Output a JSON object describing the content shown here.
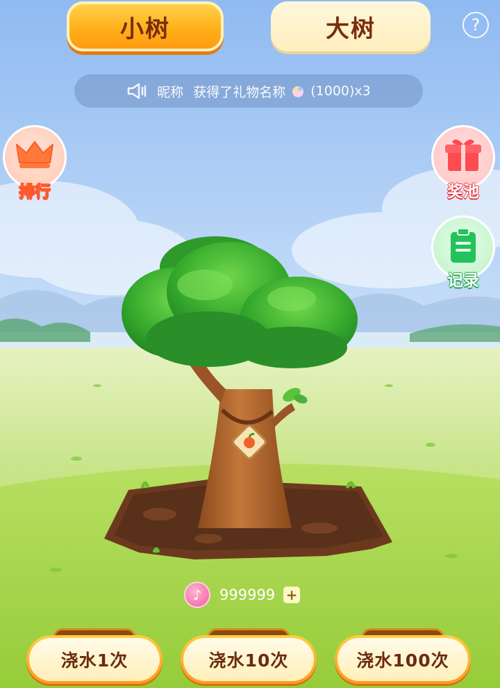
{
  "tabs": {
    "small": "小树",
    "big": "大树"
  },
  "help_glyph": "?",
  "marquee": {
    "nickname": "昵称",
    "action": "获得了礼物名称",
    "amount": "(1000)x3"
  },
  "side": {
    "rank": "排行",
    "prize_pool": "奖池",
    "record": "记录"
  },
  "coins": {
    "value": "999999",
    "plus": "+"
  },
  "water_buttons": [
    "浇水1次",
    "浇水10次",
    "浇水100次"
  ],
  "icons": [
    "help-icon",
    "speaker-icon",
    "gift-item-icon",
    "crown-icon",
    "gift-box-icon",
    "clipboard-icon",
    "apple-badge-icon",
    "music-coin-icon",
    "plus-icon"
  ],
  "colors": {
    "tab_active": "#ffb01c",
    "tab_text": "#7a2d0a",
    "rank_accent": "#ff5a2a",
    "pool_accent": "#e8323a",
    "record_accent": "#18a54a",
    "coin": "#f25c9b"
  }
}
